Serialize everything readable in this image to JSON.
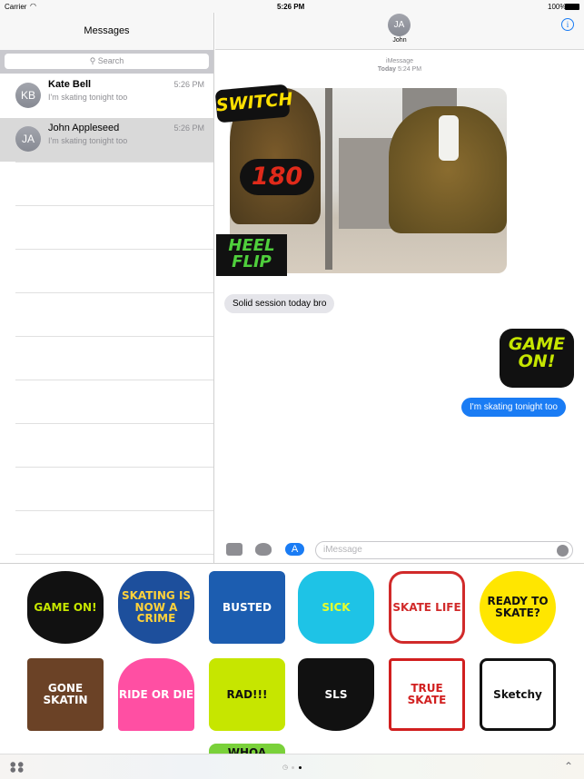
{
  "status": {
    "carrier": "Carrier",
    "time": "5:26 PM",
    "battery": "100%"
  },
  "sidebar": {
    "title": "Messages",
    "search_placeholder": "Search",
    "conversations": [
      {
        "initials": "KB",
        "name": "Kate Bell",
        "preview": "I'm skating tonight too",
        "time": "5:26 PM",
        "selected": false
      },
      {
        "initials": "JA",
        "name": "John Appleseed",
        "preview": "I'm skating tonight too",
        "time": "5:26 PM",
        "selected": true
      }
    ]
  },
  "chat": {
    "contact_initials": "JA",
    "contact_name": "John",
    "service": "iMessage",
    "timestamp_day": "Today",
    "timestamp_time": "5:24 PM",
    "photo_stickers": [
      "SWITCH",
      "180",
      "HEEL FLIP"
    ],
    "messages": [
      {
        "from": "them",
        "text": "Solid session today bro"
      },
      {
        "from": "me",
        "sticker": "GAME ON!"
      },
      {
        "from": "me",
        "text": "I'm skating tonight too"
      }
    ],
    "input_placeholder": "iMessage"
  },
  "stickers": [
    "GAME ON!",
    "SKATING IS NOW A CRIME",
    "BUSTED",
    "SICK",
    "SKATE LIFE",
    "READY TO SKATE?",
    "GONE SKATIN",
    "RIDE OR DIE",
    "RAD!!!",
    "SLS",
    "TRUE SKATE",
    "Sketchy",
    "WHOA"
  ],
  "colors": {
    "accent": "#1a7cf4",
    "incoming_bubble": "#e5e5ea",
    "selected_row": "#d9d9d9"
  }
}
